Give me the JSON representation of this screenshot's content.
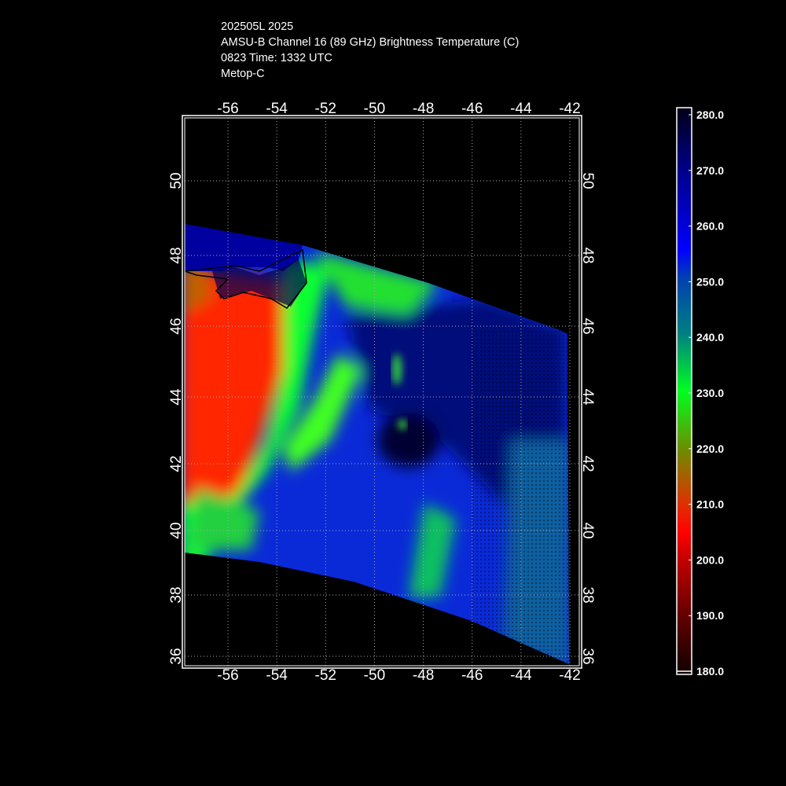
{
  "header": {
    "line1": "202505L 2025",
    "line2": "AMSU-B Channel 16 (89 GHz) Brightness Temperature (C)",
    "line3": "0823 Time: 1332 UTC",
    "line4": "Metop-C"
  },
  "map": {
    "lon_ticks": [
      "-56",
      "-54",
      "-52",
      "-50",
      "-48",
      "-46",
      "-44",
      "-42"
    ],
    "lat_ticks": [
      "50",
      "48",
      "46",
      "44",
      "42",
      "40",
      "38",
      "36"
    ],
    "lon_range": [
      -57.8,
      -41.5
    ],
    "lat_range": [
      35.9,
      51.9
    ]
  },
  "colorbar": {
    "labels": [
      "280.0",
      "270.0",
      "260.0",
      "250.0",
      "240.0",
      "230.0",
      "220.0",
      "210.0",
      "200.0",
      "190.0",
      "180.0"
    ],
    "range": [
      180,
      280
    ],
    "stops": [
      {
        "value": 280,
        "color": "#000016"
      },
      {
        "value": 270,
        "color": "#000080"
      },
      {
        "value": 260,
        "color": "#0000d0"
      },
      {
        "value": 255,
        "color": "#0000ff"
      },
      {
        "value": 250,
        "color": "#0040b0"
      },
      {
        "value": 240,
        "color": "#008080"
      },
      {
        "value": 230,
        "color": "#00ff20"
      },
      {
        "value": 220,
        "color": "#6a9000"
      },
      {
        "value": 210,
        "color": "#e03000"
      },
      {
        "value": 205,
        "color": "#ff0000"
      },
      {
        "value": 200,
        "color": "#c00000"
      },
      {
        "value": 190,
        "color": "#600000"
      },
      {
        "value": 180,
        "color": "#100000"
      }
    ]
  }
}
